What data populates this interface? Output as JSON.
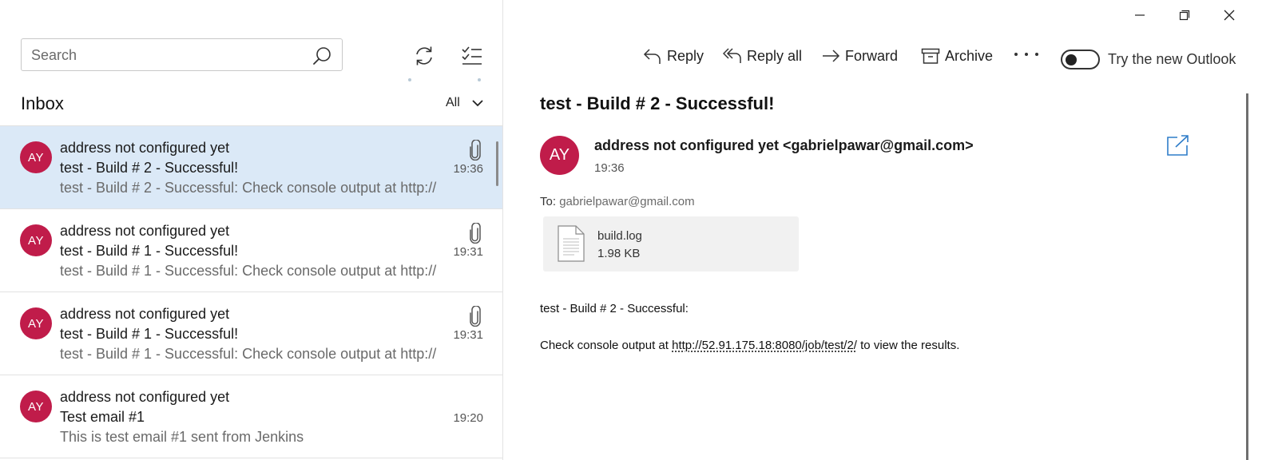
{
  "colors": {
    "selected_row": "#dbe9f7",
    "avatar": "#c01c4a"
  },
  "search": {
    "placeholder": "Search"
  },
  "folder": {
    "title": "Inbox",
    "filter_label": "All"
  },
  "messages": [
    {
      "initials": "AY",
      "from": "address not configured yet",
      "subject": "test - Build # 2 - Successful!",
      "preview": "test - Build # 2 - Successful: Check console output at http://",
      "time": "19:36",
      "has_attachment": true,
      "selected": true
    },
    {
      "initials": "AY",
      "from": "address not configured yet",
      "subject": "test - Build # 1 - Successful!",
      "preview": "test - Build # 1 - Successful: Check console output at http://",
      "time": "19:31",
      "has_attachment": true,
      "selected": false
    },
    {
      "initials": "AY",
      "from": "address not configured yet",
      "subject": "test - Build # 1 - Successful!",
      "preview": "test - Build # 1 - Successful: Check console output at http://",
      "time": "19:31",
      "has_attachment": true,
      "selected": false
    },
    {
      "initials": "AY",
      "from": "address not configured yet",
      "subject": "Test email #1",
      "preview": "This is test email #1 sent from Jenkins",
      "time": "19:20",
      "has_attachment": false,
      "selected": false
    }
  ],
  "toolbar": {
    "reply": "Reply",
    "reply_all": "Reply all",
    "forward": "Forward",
    "archive": "Archive",
    "toggle_label": "Try the new Outlook"
  },
  "reading": {
    "subject": "test - Build # 2 - Successful!",
    "sender_initials": "AY",
    "sender": "address not configured yet <gabrielpawar@gmail.com>",
    "time": "19:36",
    "to_label": "To:",
    "to_address": "gabrielpawar@gmail.com",
    "attachment": {
      "name": "build.log",
      "size": "1.98 KB"
    },
    "body_line1": "test - Build # 2 - Successful:",
    "body_prefix": "Check console output at ",
    "body_link": "http://52.91.175.18:8080/job/test/2/",
    "body_suffix": " to view the results."
  }
}
